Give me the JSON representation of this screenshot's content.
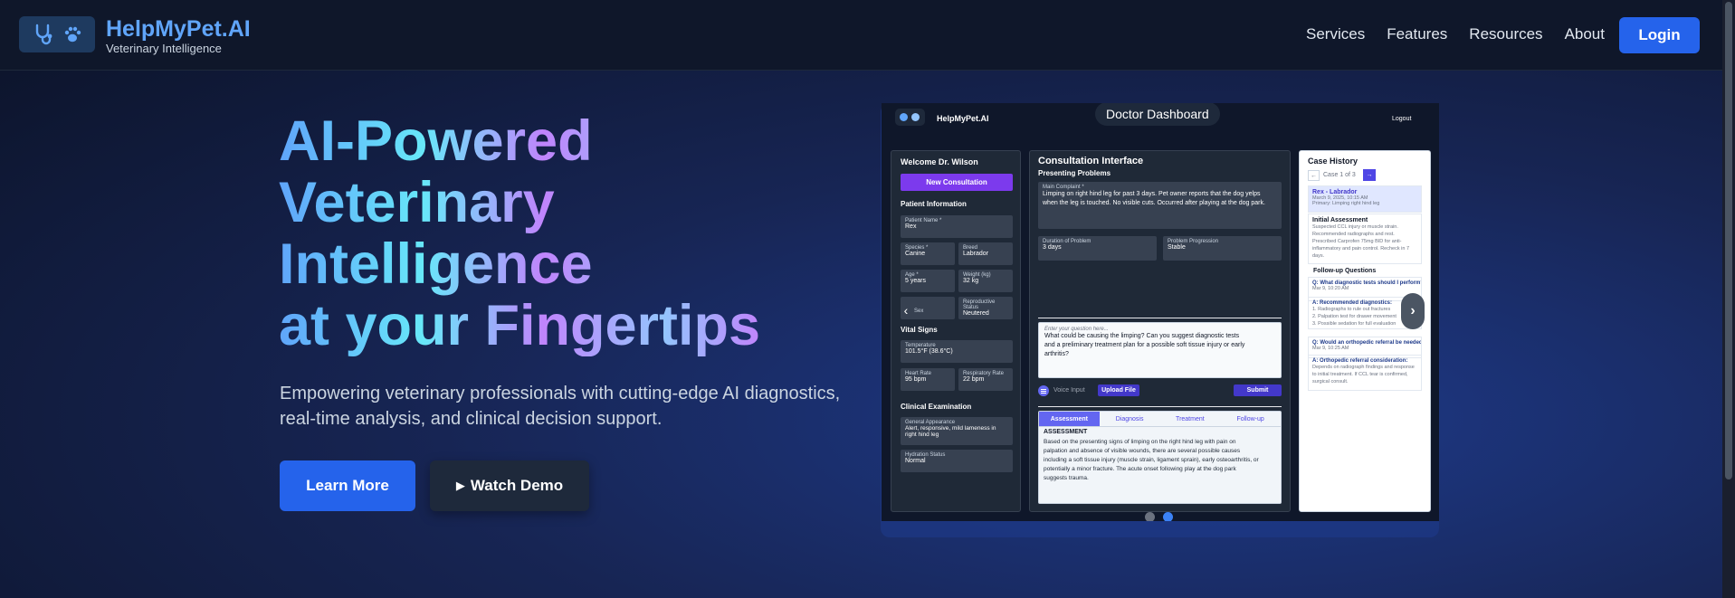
{
  "header": {
    "brand_name": "HelpMyPet.AI",
    "brand_tagline": "Veterinary Intelligence",
    "nav": [
      "Services",
      "Features",
      "Resources",
      "About"
    ],
    "login_label": "Login"
  },
  "hero": {
    "title_lines": [
      "AI-Powered",
      "Veterinary",
      "Intelligence",
      "at your Fingertips"
    ],
    "subtitle": "Empowering veterinary professionals with cutting-edge AI diagnostics, real-time analysis, and clinical decision support.",
    "learn_more": "Learn More",
    "watch_demo": "Watch Demo",
    "play_glyph": "▶"
  },
  "preview": {
    "slide_label": "Doctor Dashboard",
    "app_name": "HelpMyPet.AI",
    "logout": "Logout",
    "left": {
      "welcome": "Welcome Dr. Wilson",
      "new_consultation": "New Consultation",
      "patient_info": "Patient Information",
      "patient_name_label": "Patient Name *",
      "patient_name": "Rex",
      "species_label": "Species *",
      "species": "Canine",
      "breed_label": "Breed",
      "breed": "Labrador",
      "age_label": "Age *",
      "age": "5 years",
      "weight_label": "Weight (kg)",
      "weight": "32 kg",
      "sex_label": "Sex",
      "repro_label": "Reproductive Status",
      "repro": "Neutered",
      "vital_signs": "Vital Signs",
      "temp_label": "Temperature",
      "temp": "101.5°F (38.6°C)",
      "hr_label": "Heart Rate",
      "hr": "95 bpm",
      "rr_label": "Respiratory Rate",
      "rr": "22 bpm",
      "clinical": "Clinical Examination",
      "appearance_label": "General Appearance",
      "appearance": "Alert, responsive, mild lameness in right hind leg",
      "hydration_label": "Hydration Status",
      "hydration": "Normal"
    },
    "mid": {
      "title": "Consultation Interface",
      "presenting": "Presenting Problems",
      "complaint_label": "Main Complaint *",
      "complaint": "Limping on right hind leg for past 3 days. Pet owner reports that the dog yelps when the leg is touched. No visible cuts. Occurred after playing at the dog park.",
      "duration_label": "Duration of Problem",
      "duration": "3 days",
      "progression_label": "Problem Progression",
      "progression": "Stable",
      "question_placeholder": "Enter your question here...",
      "question": "What could be causing the limping? Can you suggest diagnostic tests and a preliminary treatment plan for a possible soft tissue injury or early arthritis?",
      "voice_input": "Voice Input",
      "upload": "Upload File",
      "submit": "Submit",
      "tabs": [
        "Assessment",
        "Diagnosis",
        "Treatment",
        "Follow-up"
      ],
      "assessment_heading": "ASSESSMENT",
      "assessment_text": "Based on the presenting signs of limping on the right hind leg with pain on palpation and absence of visible wounds, there are several possible causes including a soft tissue injury (muscle strain, ligament sprain), early osteoarthritis, or potentially a minor fracture. The acute onset following play at the dog park suggests trauma."
    },
    "right": {
      "title": "Case History",
      "prev": "←",
      "pager": "Case 1 of 3",
      "next": "→",
      "case_name": "Rex - Labrador",
      "case_date": "March 9, 2025, 10:15 AM",
      "case_primary": "Primary: Limping right hind leg",
      "initial_title": "Initial Assessment",
      "initial_text": "Suspected CCL injury or muscle strain. Recommended radiographs and rest. Prescribed Carprofen 75mg BID for anti-inflammatory and pain control. Recheck in 7 days.",
      "followup_title": "Follow-up Questions",
      "q1": "Q: What diagnostic tests should I perform?",
      "q1_date": "Mar 9, 10:20 AM",
      "a1": "A: Recommended diagnostics:",
      "a1_items": [
        "1. Radiographs to rule out fractures",
        "2. Palpation test for drawer movement",
        "3. Possible sedation for full evaluation"
      ],
      "q2": "Q: Would an orthopedic referral be needed?",
      "q2_date": "Mar 9, 10:25 AM",
      "a2": "A: Orthopedic referral consideration:",
      "a2_text": "Depends on radiograph findings and response to initial treatment. If CCL tear is confirmed, surgical consult."
    },
    "arrow_left": "‹",
    "arrow_right": "›"
  },
  "colors": {
    "accent": "#2563eb",
    "brand": "#60a5fa",
    "purple": "#7c3aed"
  }
}
